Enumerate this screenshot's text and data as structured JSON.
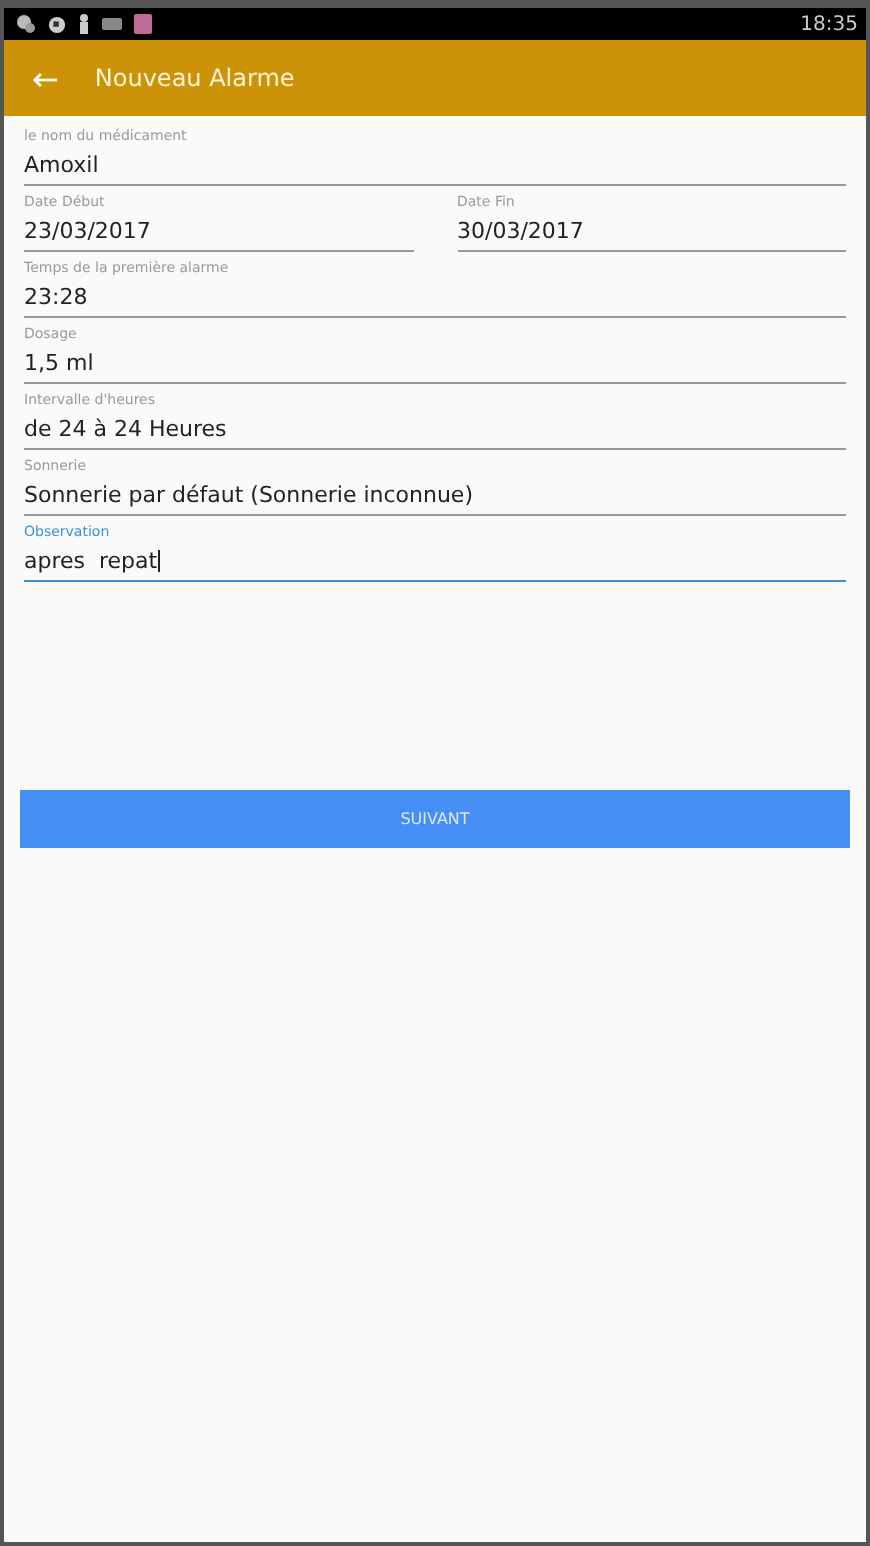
{
  "status_bar": {
    "time": "18:35"
  },
  "app_bar": {
    "back_icon": "←",
    "title": "Nouveau Alarme"
  },
  "rows": [
    [
      {
        "label": "le nom du médicament",
        "value": "Amoxil",
        "focused": false
      }
    ],
    [
      {
        "label": "Date Début",
        "value": "23/03/2017",
        "focused": false
      },
      {
        "label": "Date Fin",
        "value": "30/03/2017",
        "focused": false
      }
    ],
    [
      {
        "label": "Temps de la première alarme",
        "value": "23:28",
        "focused": false
      }
    ],
    [
      {
        "label": "Dosage",
        "value": "1,5 ml",
        "focused": false
      }
    ],
    [
      {
        "label": "Intervalle d'heures",
        "value": "de 24 à 24 Heures",
        "focused": false
      }
    ],
    [
      {
        "label": "Sonnerie",
        "value": "Sonnerie par défaut (Sonnerie inconnue)",
        "focused": false
      }
    ],
    [
      {
        "label": "Observation",
        "value": "apres  repat",
        "focused": true
      }
    ]
  ],
  "button": "SUIVANT"
}
